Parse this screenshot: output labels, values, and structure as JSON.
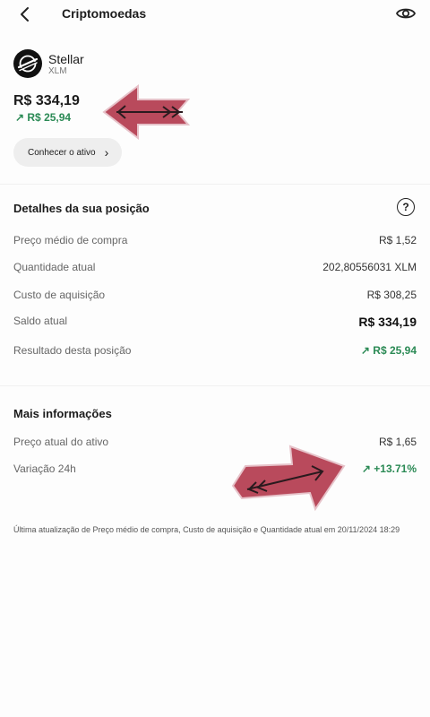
{
  "header": {
    "title": "Criptomoedas"
  },
  "asset": {
    "name": "Stellar",
    "ticker": "XLM",
    "price": "R$ 334,19",
    "change": "↗ R$ 25,94"
  },
  "chip": {
    "label": "Conhecer o ativo",
    "chevron": "›"
  },
  "position": {
    "title": "Detalhes da sua posição",
    "help": "?",
    "rows": [
      {
        "label": "Preço médio de compra",
        "value": "R$ 1,52"
      },
      {
        "label": "Quantidade atual",
        "value": "202,80556031 XLM"
      },
      {
        "label": "Custo de aquisição",
        "value": "R$ 308,25"
      },
      {
        "label": "Saldo atual",
        "value": "R$ 334,19"
      },
      {
        "label": "Resultado desta posição",
        "value": "↗ R$ 25,94"
      }
    ]
  },
  "more": {
    "title": "Mais informações",
    "rows": [
      {
        "label": "Preço atual do ativo",
        "value": "R$ 1,65"
      },
      {
        "label": "Variação 24h",
        "value": "↗ +13.71%"
      }
    ]
  },
  "footnote": "Última atualização de Preço médio de compra, Custo de aquisição e Quantidade atual em 20/11/2024 18:29",
  "colors": {
    "positive": "#2b8a55",
    "annotation_arrow": "#b94a5c"
  }
}
